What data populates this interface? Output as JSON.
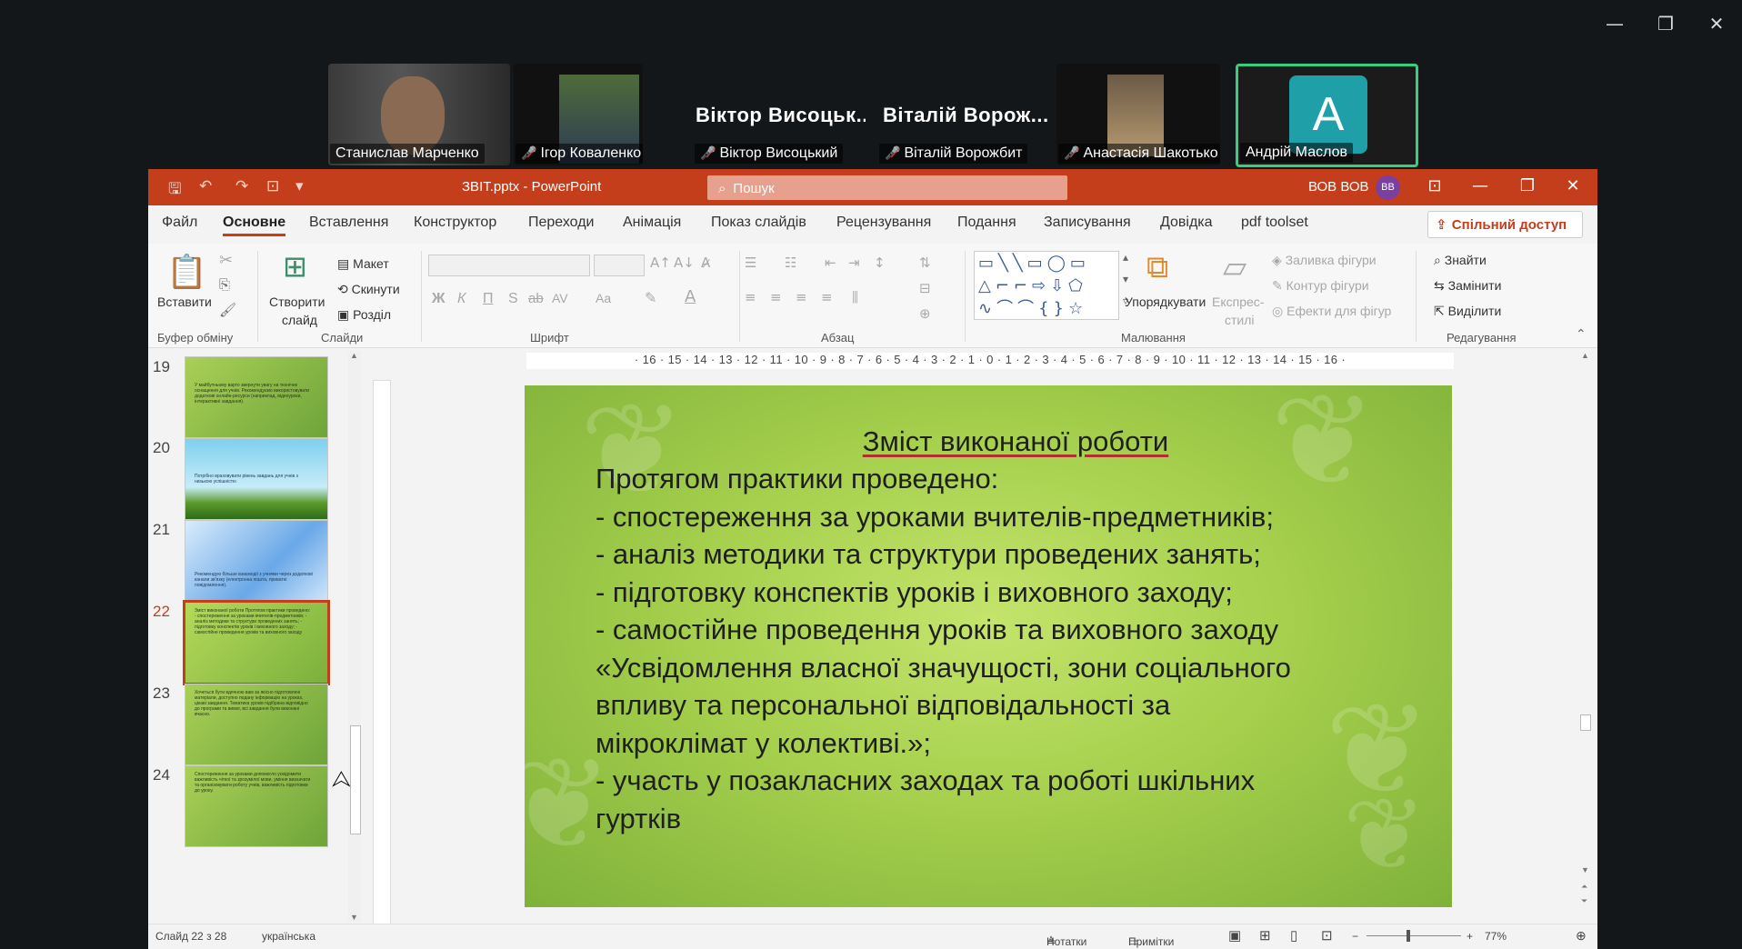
{
  "meeting": {
    "participants": [
      {
        "name": "Станислав Марченко",
        "muted": false
      },
      {
        "name": "Ігор Коваленко",
        "muted": true
      },
      {
        "name": "Віктор Висоцький",
        "display": "Віктор Висоцьк...",
        "muted": true
      },
      {
        "name": "Віталій Ворожбит",
        "display": "Віталій Ворож...",
        "muted": true
      },
      {
        "name": "Анастасія Шакотько",
        "muted": true
      },
      {
        "name": "Андрій Маслов",
        "initial": "A",
        "muted": false,
        "active_speaker": true
      }
    ],
    "window_controls": {
      "minimize": "—",
      "restore": "❐",
      "close": "✕"
    }
  },
  "ppt": {
    "file_title": "ЗВІТ.pptx  -  PowerPoint",
    "search_placeholder": "Пошук",
    "user_name": "ВОВ ВОВ",
    "user_initials": "ВВ",
    "menu": [
      "Файл",
      "Основне",
      "Вставлення",
      "Конструктор",
      "Переходи",
      "Анімація",
      "Показ слайдів",
      "Рецензування",
      "Подання",
      "Записування",
      "Довідка",
      "pdf toolset"
    ],
    "active_menu": "Основне",
    "share_label": "Спільний доступ",
    "ribbon": {
      "paste": "Вставити",
      "clipboard_group": "Буфер обміну",
      "new_slide_line1": "Створити",
      "new_slide_line2": "слайд",
      "layout": "Макет",
      "reset": "Скинути",
      "section": "Розділ",
      "slides_group": "Слайди",
      "font_group": "Шрифт",
      "paragraph_group": "Абзац",
      "arrange": "Упорядкувати",
      "quick_styles_line1": "Експрес-",
      "quick_styles_line2": "стилі",
      "shape_fill": "Заливка фігури",
      "shape_outline": "Контур фігури",
      "shape_effects": "Ефекти для фігур",
      "drawing_group": "Малювання",
      "find": "Знайти",
      "replace": "Замінити",
      "select": "Виділити",
      "editing_group": "Редагування",
      "bold": "Ж",
      "italic": "К",
      "underline": "П",
      "shadow": "S",
      "strike": "ab",
      "spacing": "AV",
      "case": "Aa"
    },
    "thumbnails": [
      {
        "num": "19",
        "text": "У майбутньому варто звернути увагу на технічне оснащення для учнів. Рекомендуємо використовувати додаткові онлайн-ресурси (наприклад, відеоуроки, інтерактивні завдання)."
      },
      {
        "num": "20",
        "text": "Потрібно враховувати рівень завдань для учнів з низькою успішністю"
      },
      {
        "num": "21",
        "text": "Рекомендую більше взаємодії з учнями через додаткові канали зв'язку (електронна пошта, приватні повідомлення)."
      },
      {
        "num": "22",
        "text": "Зміст виконаної роботи Протягом практики проведено: - спостереження за уроками вчителів-предметників; - аналіз методики та структури проведених занять; - підготовку конспектів уроків і виховного заходу; - самостійне проведення уроків та виховного заходу"
      },
      {
        "num": "23",
        "text": "Хочеться бути вдячною вам за якісно підготовлені матеріали, доступно подану інформацію на уроках, цікаві завдання. Тематика уроків підібрана відповідно до програми та вимог, всі завдання були виконані вчасно."
      },
      {
        "num": "24",
        "text": "Спостереження за уроками допомогло усвідомити важливість чіткої та зрозумілої мови, уміння визначати та організовувати роботу учнів, важливість підготовки до уроку."
      }
    ],
    "current_thumb": "22",
    "ruler_text": "· 16 · 15 · 14 · 13 · 12 · 11 · 10 · 9 · 8 · 7 · 6 · 5 · 4 · 3 · 2 · 1 · 0 · 1 · 2 · 3 · 4 · 5 · 6 · 7 · 8 · 9 · 10 · 11 · 12 · 13 · 14 · 15 · 16 ·",
    "slide": {
      "title": "Зміст виконаної роботи",
      "lines": [
        "Протягом практики проведено:",
        "- спостереження за уроками вчителів-предметників;",
        "- аналіз методики та структури проведених занять;",
        "- підготовку конспектів уроків і виховного заходу;",
        "- самостійне проведення  уроків та виховного заходу",
        "«Усвідомлення власної значущості, зони соціального",
        "впливу та персональної відповідальності за",
        "мікроклімат у колективі.»;",
        "- участь у позакласних заходах та роботі шкільних",
        "гуртків"
      ]
    },
    "status": {
      "slide_info": "Слайд 22 з 28",
      "language": "українська",
      "notes": "Нотатки",
      "comments": "Примітки",
      "zoom": "77%"
    },
    "colors": {
      "accent": "#c43e1c",
      "active_speaker_border": "#35d07f",
      "avatar_bg": "#1fa0a8"
    }
  }
}
